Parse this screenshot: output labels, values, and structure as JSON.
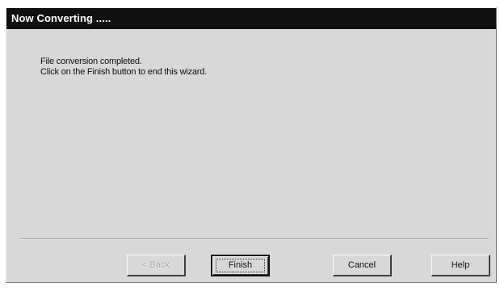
{
  "window": {
    "title": "Now Converting ....."
  },
  "message": {
    "line1": "File conversion completed.",
    "line2": "Click on the Finish button to end this wizard."
  },
  "buttons": {
    "back": "< Back",
    "finish": "Finish",
    "cancel": "Cancel",
    "help": "Help"
  },
  "colors": {
    "titlebar": "#101010",
    "dialog_background": "#d8d8d8",
    "disabled_text": "#a8a8a8"
  }
}
